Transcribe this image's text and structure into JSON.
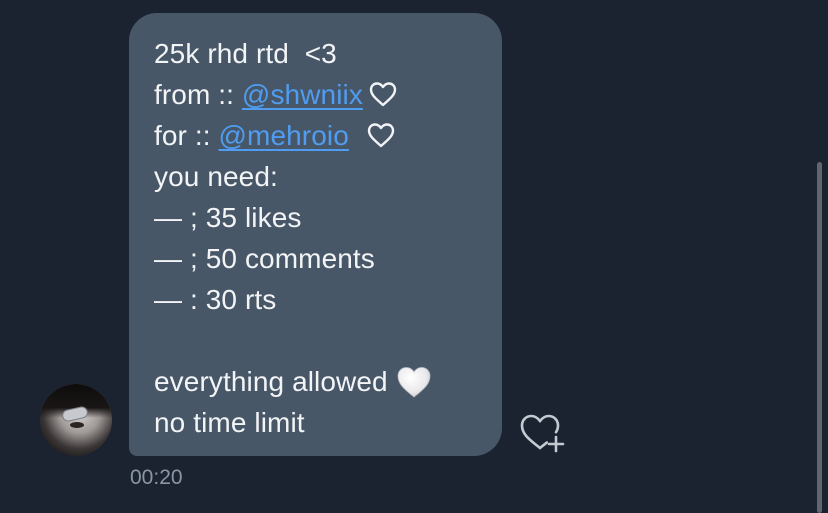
{
  "message": {
    "lines": {
      "l1": "25k rhd rtd  <3",
      "l2_prefix": "from :: ",
      "l2_mention": "@shwniix",
      "l3_prefix": "for :: ",
      "l3_mention": "@mehroio",
      "l4": "you need:",
      "l5": "— ; 35 likes",
      "l6": "— ; 50 comments",
      "l7": "— : 30 rts",
      "l9": "everything allowed",
      "l10": "no time limit"
    },
    "timestamp": "00:20"
  },
  "icons": {
    "outline_heart": "heart-outline-icon",
    "white_heart": "white-heart-emoji",
    "react": "heart-plus-icon"
  },
  "colors": {
    "background": "#1c2330",
    "bubble": "#485768",
    "mention": "#4f9cf0",
    "timestamp": "#8a96a6"
  }
}
